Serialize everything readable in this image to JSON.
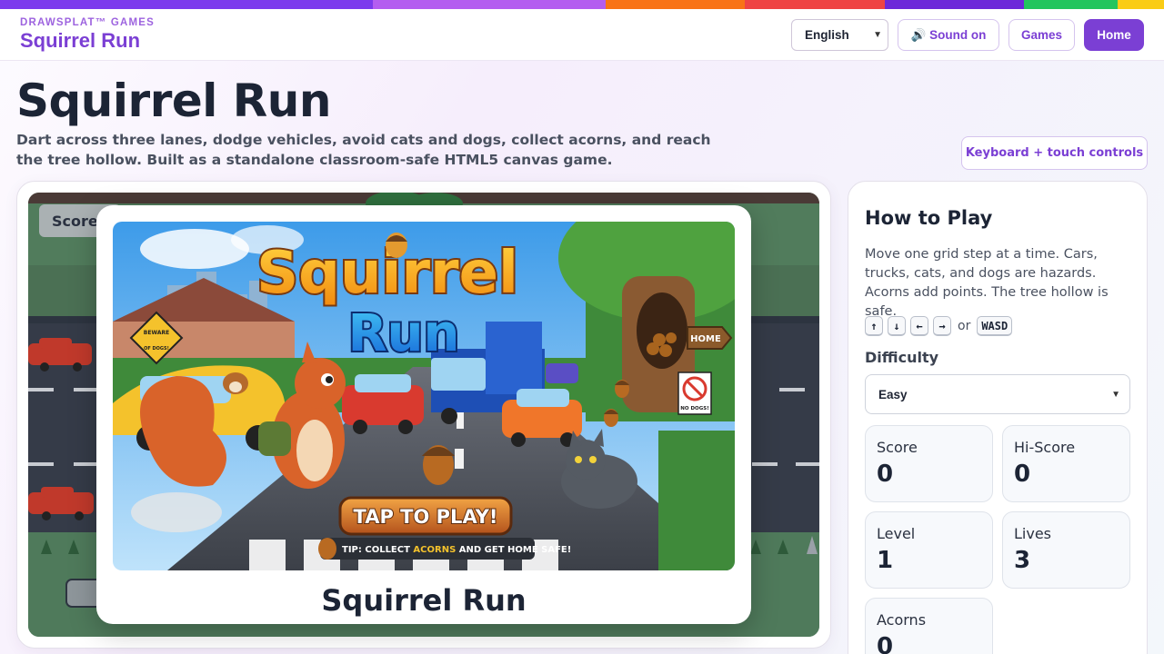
{
  "header": {
    "brand_small": "DRAWSPLAT™ GAMES",
    "brand_title": "Squirrel Run",
    "language": "English",
    "sound_label": "🔊 Sound on",
    "games_label": "Games",
    "home_label": "Home"
  },
  "rainbow_colors": [
    "#7c3aed",
    "#b45df0",
    "#f97316",
    "#ef4444",
    "#6d28d9",
    "#22c55e",
    "#facc15"
  ],
  "page": {
    "title": "Squirrel Run",
    "subtitle": "Dart across three lanes, dodge vehicles, avoid cats and dogs, collect acorns, and reach the tree hollow. Built as a standalone classroom-safe HTML5 canvas game.",
    "controls_badge": "Keyboard + touch controls"
  },
  "game": {
    "hud_score_label": "Score",
    "splash_title_line1": "Squirrel",
    "splash_title_line2": "Run",
    "splash_button": "TAP TO PLAY!",
    "splash_tip_prefix": "TIP: COLLECT ",
    "splash_tip_highlight": "ACORNS",
    "splash_tip_suffix": " AND GET HOME SAFE!",
    "sign_beware_line1": "BEWARE",
    "sign_beware_line2": "OF DOGS!",
    "sign_home": "HOME",
    "sign_no_dogs": "NO DOGS!",
    "overlay_title": "Squirrel Run"
  },
  "sidebar": {
    "heading": "How to Play",
    "description": "Move one grid step at a time. Cars, trucks, cats, and dogs are hazards. Acorns add points. The tree hollow is safe.",
    "keys": [
      "↑",
      "↓",
      "←",
      "→"
    ],
    "keys_or": "or",
    "keys_alt": "WASD",
    "difficulty_label": "Difficulty",
    "difficulty_value": "Easy",
    "stats": [
      {
        "label": "Score",
        "value": "0"
      },
      {
        "label": "Hi-Score",
        "value": "0"
      },
      {
        "label": "Level",
        "value": "1"
      },
      {
        "label": "Lives",
        "value": "3"
      },
      {
        "label": "Acorns",
        "value": "0"
      }
    ]
  }
}
